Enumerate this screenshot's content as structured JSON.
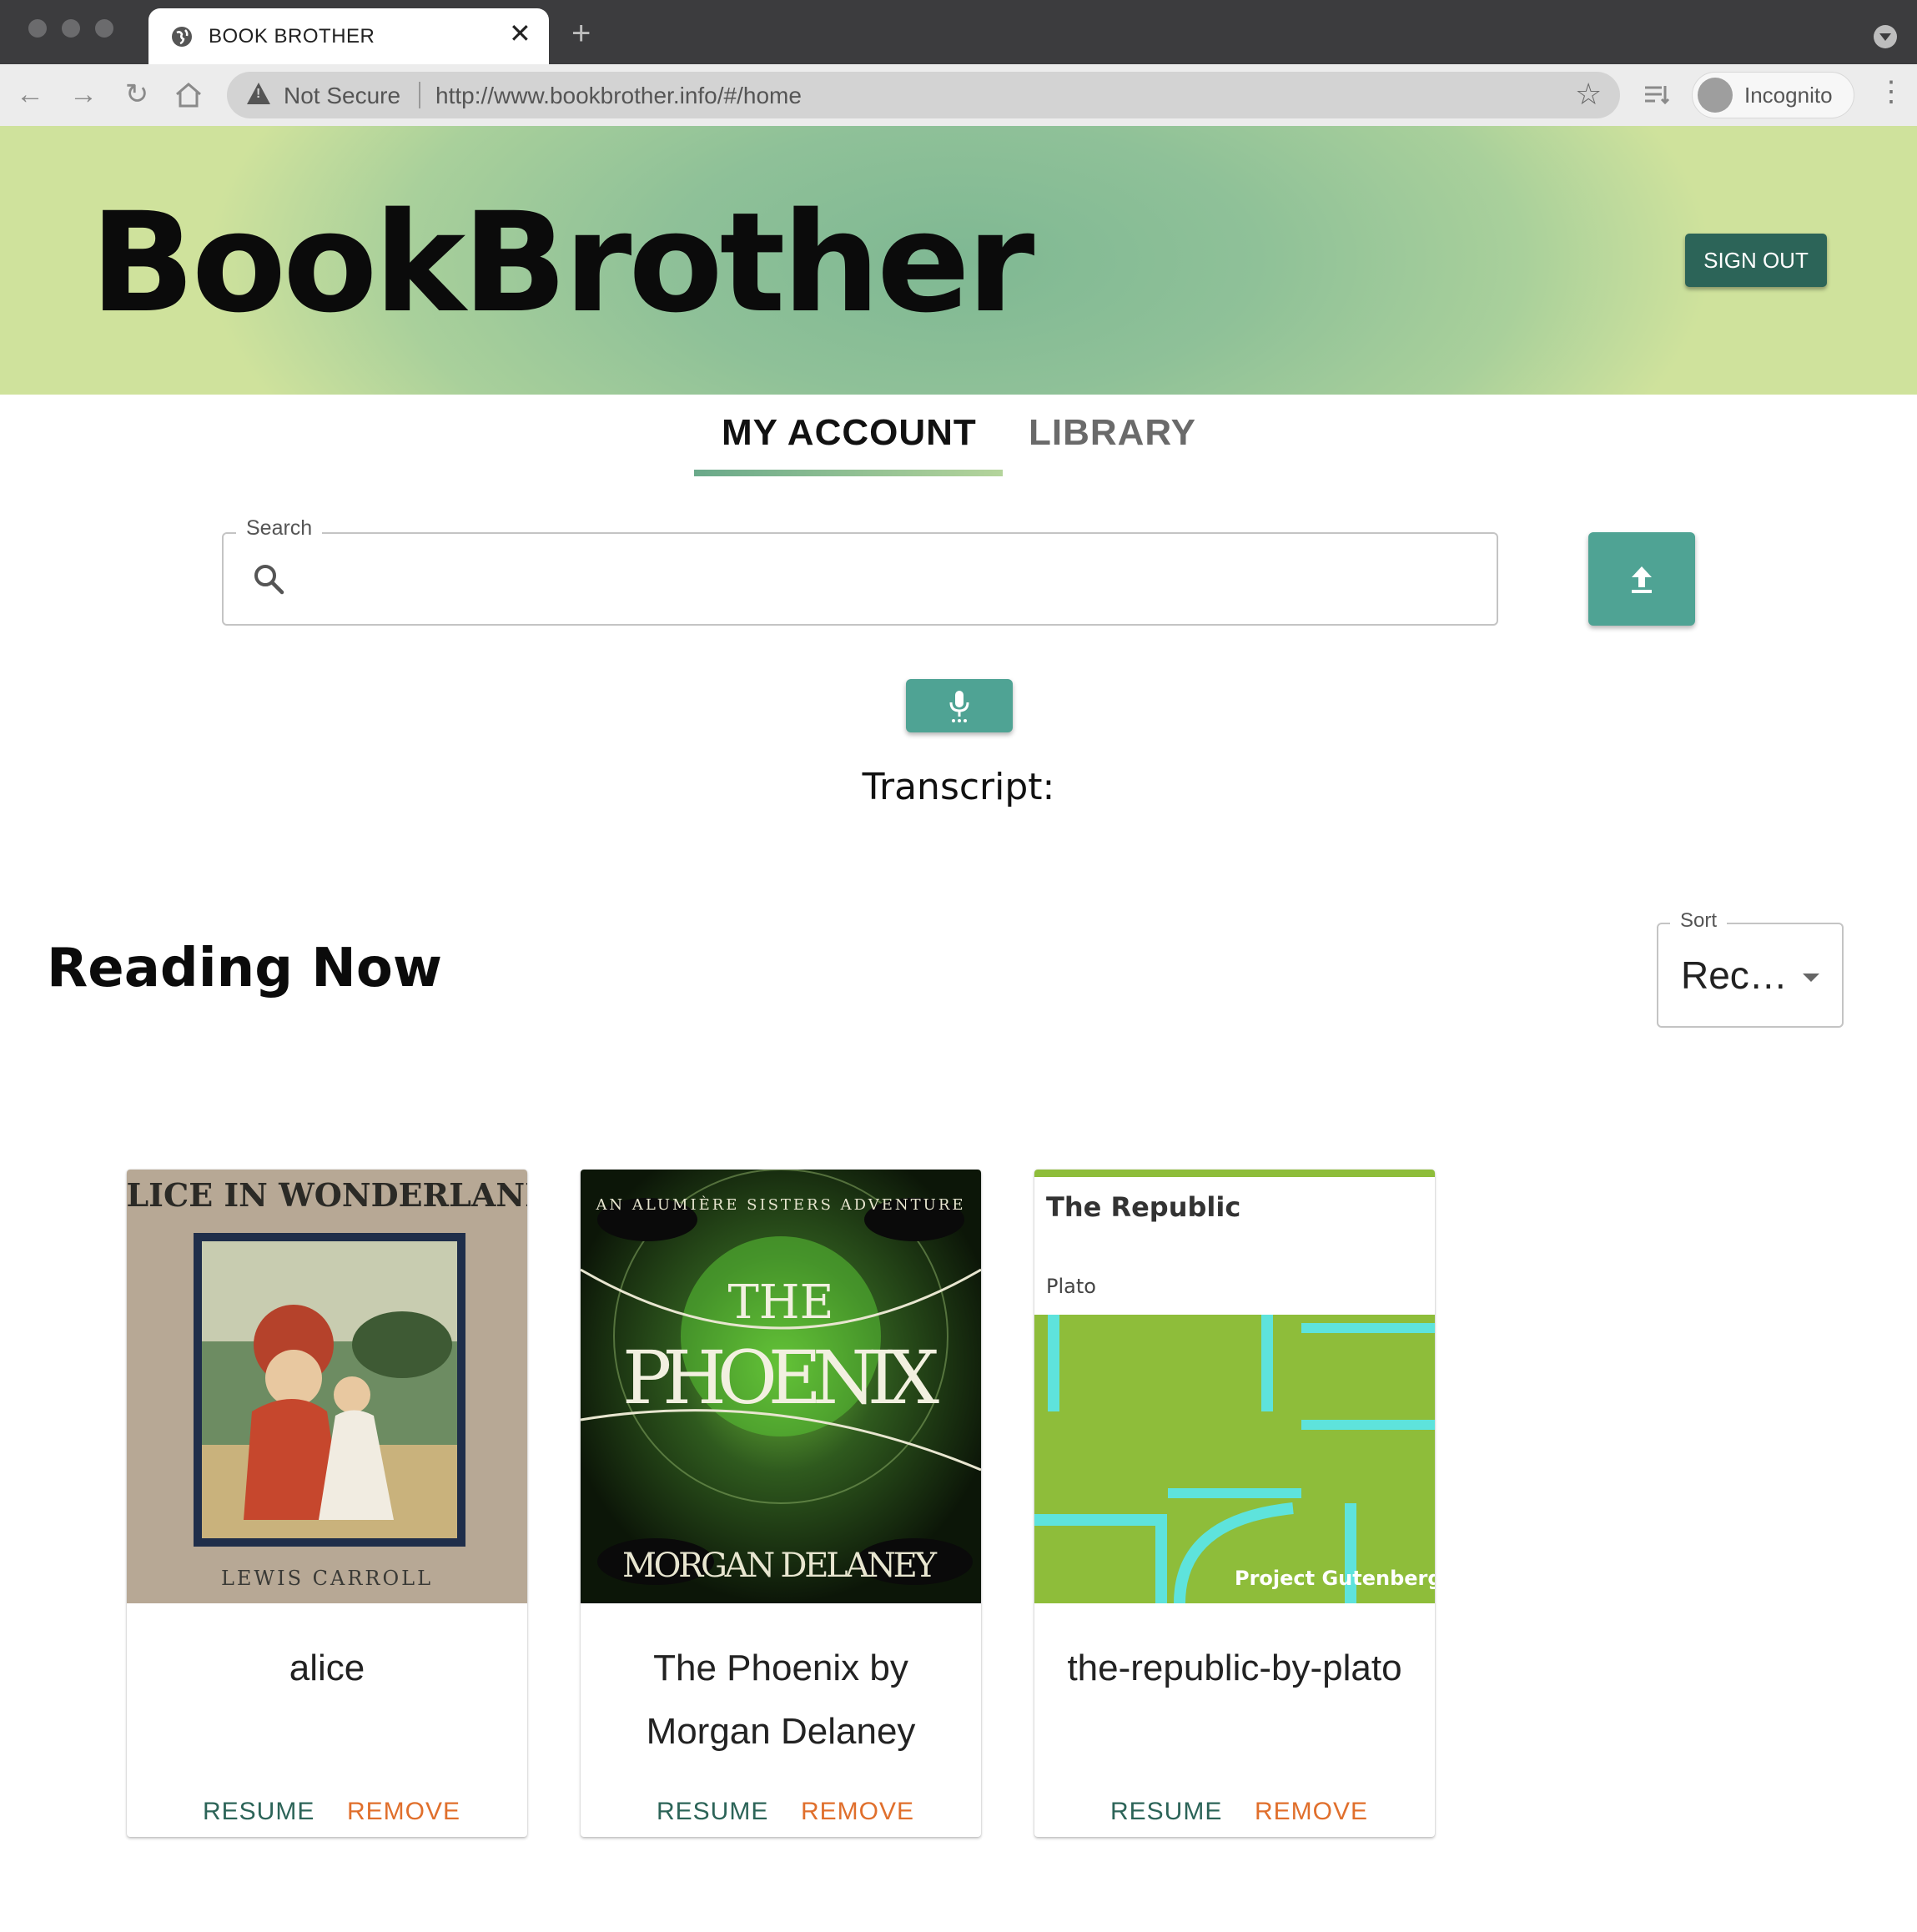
{
  "browser": {
    "tab_title": "BOOK BROTHER",
    "security_label": "Not Secure",
    "url": "http://www.bookbrother.info/#/home",
    "profile_label": "Incognito"
  },
  "header": {
    "brand": "BookBrother",
    "sign_out_label": "SIGN OUT"
  },
  "nav": {
    "tabs": [
      {
        "label": "MY ACCOUNT",
        "active": true
      },
      {
        "label": "LIBRARY",
        "active": false
      }
    ]
  },
  "search": {
    "label": "Search",
    "value": ""
  },
  "voice": {
    "transcript_label": "Transcript:"
  },
  "reading_now": {
    "title": "Reading Now",
    "sort_label": "Sort",
    "sort_value": "Rec…",
    "books": [
      {
        "title": "alice",
        "cover_title": "ALICE IN WONDERLAND",
        "cover_author": "LEWIS CARROLL",
        "resume_label": "RESUME",
        "remove_label": "REMOVE"
      },
      {
        "title": "The Phoenix by Morgan Delaney",
        "cover_series": "AN ALUMIÈRE SISTERS ADVENTURE",
        "cover_the": "THE",
        "cover_title": "PHOENIX",
        "cover_author": "MORGAN DELANEY",
        "resume_label": "RESUME",
        "remove_label": "REMOVE"
      },
      {
        "title": "the-republic-by-plato",
        "cover_title": "The Republic",
        "cover_author": "Plato",
        "cover_publisher": "Project Gutenberg",
        "resume_label": "RESUME",
        "remove_label": "REMOVE"
      }
    ]
  },
  "colors": {
    "accent": "#4fa394",
    "dark_accent": "#2c6458",
    "remove": "#e06f2c"
  }
}
